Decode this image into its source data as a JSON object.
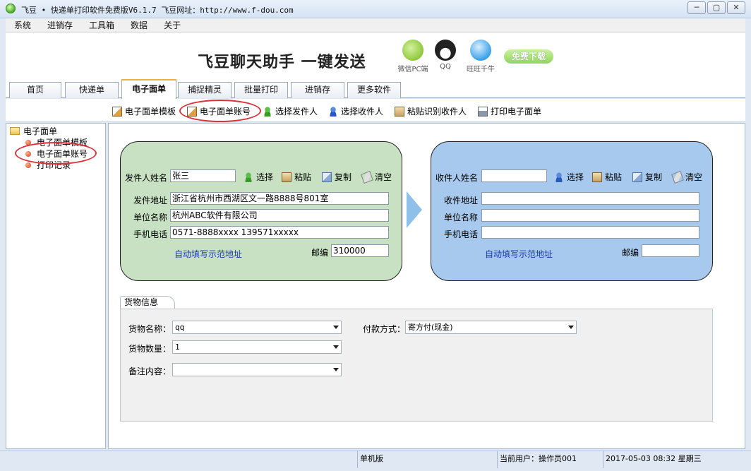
{
  "window": {
    "title": "飞豆 • 快递单打印软件免费版V6.1.7  飞豆网址：http://www.f-dou.com",
    "buttons": [
      "─",
      "▢",
      "✕"
    ]
  },
  "menu": [
    "系统",
    "进销存",
    "工具箱",
    "数据",
    "关于"
  ],
  "banner": {
    "title": "飞豆聊天助手 一键发送",
    "apps": [
      {
        "label": "微信PC端",
        "icon": "wechat-icon",
        "color": "#8fc93a"
      },
      {
        "label": "QQ",
        "icon": "qq-penguin-icon",
        "color": "#222222"
      },
      {
        "label": "旺旺千牛",
        "icon": "wangwang-icon",
        "color": "#3aa0e8"
      }
    ],
    "download_label": "免费下载"
  },
  "tabs": [
    "首页",
    "快递单",
    "电子面单",
    "捕捉精灵",
    "批量打印",
    "进销存",
    "更多软件"
  ],
  "active_tab": "电子面单",
  "toolbar": {
    "template": "电子面单模板",
    "account": "电子面单账号",
    "choose_sender": "选择发件人",
    "choose_receiver": "选择收件人",
    "paste_receiver": "粘贴识别收件人",
    "print": "打印电子面单"
  },
  "sidebar": {
    "root": "电子面单",
    "items": [
      "电子面单模板",
      "电子面单账号",
      "打印记录"
    ]
  },
  "sender": {
    "name_label": "发件人姓名",
    "name": "张三",
    "select": "选择",
    "paste": "粘贴",
    "copy": "复制",
    "clear": "清空",
    "address_label": "发件地址",
    "address": "浙江省杭州市西湖区文一路8888号801室",
    "company_label": "单位名称",
    "company": "杭州ABC软件有限公司",
    "phone_label": "手机电话",
    "phone": "0571-8888xxxx 139571xxxxx",
    "autofill": "自动填写示范地址",
    "zip_label": "邮编",
    "zip": "310000"
  },
  "receiver": {
    "name_label": "收件人姓名",
    "name": "",
    "select": "选择",
    "paste": "粘贴",
    "copy": "复制",
    "clear": "清空",
    "address_label": "收件地址",
    "address": "",
    "company_label": "单位名称",
    "company": "",
    "phone_label": "手机电话",
    "phone": "",
    "autofill": "自动填写示范地址",
    "zip_label": "邮编",
    "zip": ""
  },
  "goods": {
    "group_title": "货物信息",
    "name_label": "货物名称：",
    "name_value": "qq",
    "qty_label": "货物数量：",
    "qty_value": "1",
    "note_label": "备注内容：",
    "note_value": "",
    "payment_label": "付款方式：",
    "payment_value": "寄方付(现金)"
  },
  "status": {
    "mode": "单机版",
    "user": "当前用户：操作员001",
    "datetime": "2017-05-03 08:32 星期三"
  },
  "colors": {
    "sender_panel": "#c8e1c3",
    "receiver_panel": "#a8c9ee",
    "annotation": "#e0303a",
    "link": "#1a3aa8"
  }
}
